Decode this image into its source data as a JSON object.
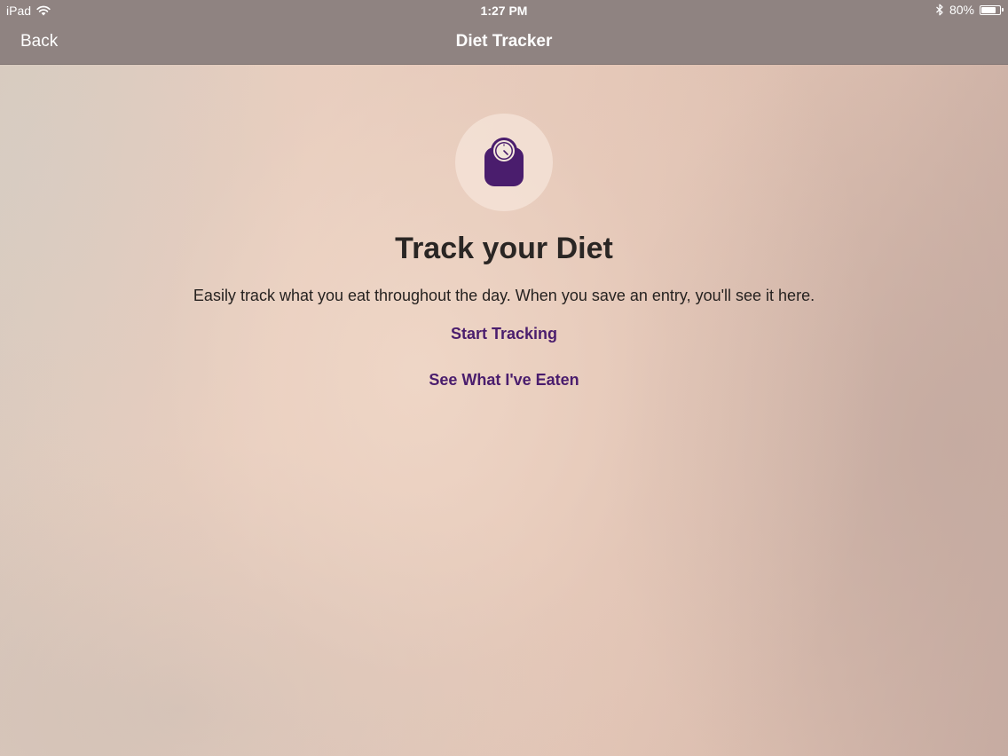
{
  "status_bar": {
    "device": "iPad",
    "time": "1:27 PM",
    "battery": "80%",
    "battery_level": 0.8
  },
  "nav": {
    "back_label": "Back",
    "title": "Diet Tracker"
  },
  "main": {
    "icon": "scale-icon",
    "heading": "Track your Diet",
    "description": "Easily track what you eat throughout the day. When you save an entry, you'll see it here.",
    "start_tracking_label": "Start Tracking",
    "see_eaten_label": "See What I've Eaten"
  },
  "colors": {
    "accent": "#4a1d6d",
    "navbar": "#8f8381"
  }
}
